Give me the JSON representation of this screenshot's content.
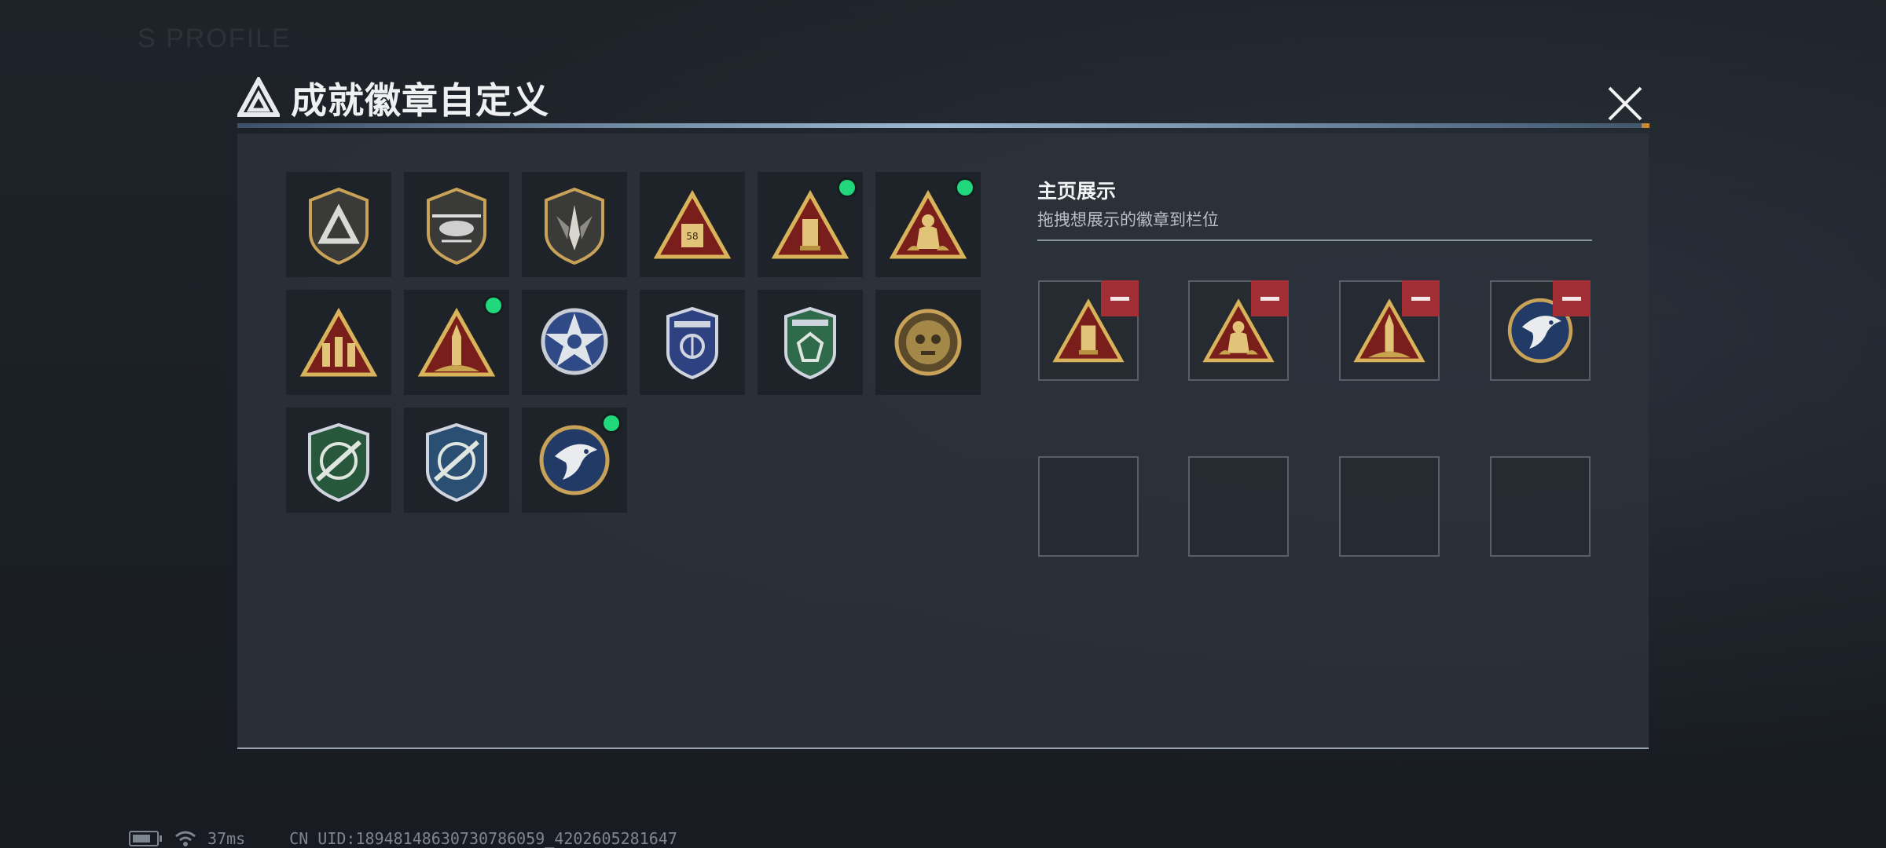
{
  "background": {
    "faint_title": "S PROFILE"
  },
  "dialog": {
    "title": "成就徽章自定义",
    "close_icon": "close-icon",
    "accent_color": "#c98a2d"
  },
  "badges": [
    {
      "icon": "shield-triangle-badge",
      "new": false
    },
    {
      "icon": "helicopter-shield-badge",
      "new": false
    },
    {
      "icon": "dagger-shield-badge",
      "new": false
    },
    {
      "icon": "triangle-58-badge",
      "new": false
    },
    {
      "icon": "triangle-vault-badge",
      "new": true
    },
    {
      "icon": "triangle-soldier-badge",
      "new": true
    },
    {
      "icon": "triangle-squad-badge",
      "new": false
    },
    {
      "icon": "triangle-missile-badge",
      "new": true
    },
    {
      "icon": "silver-star-badge",
      "new": false
    },
    {
      "icon": "blue-wing-shield-badge",
      "new": false
    },
    {
      "icon": "green-gem-shield-badge",
      "new": false
    },
    {
      "icon": "gold-mask-badge",
      "new": false
    },
    {
      "icon": "green-crosshair-shield-badge",
      "new": false
    },
    {
      "icon": "blue-crosshair-shield-badge",
      "new": false
    },
    {
      "icon": "eagle-badge",
      "new": true
    }
  ],
  "showcase": {
    "title": "主页展示",
    "subtitle": "拖拽想展示的徽章到栏位",
    "slots": [
      {
        "icon": "triangle-vault-badge",
        "filled": true
      },
      {
        "icon": "triangle-soldier-badge",
        "filled": true
      },
      {
        "icon": "triangle-missile-badge",
        "filled": true
      },
      {
        "icon": "eagle-badge",
        "filled": true
      },
      {
        "filled": false
      },
      {
        "filled": false
      },
      {
        "filled": false
      },
      {
        "filled": false
      }
    ]
  },
  "status_bar": {
    "ping": "37ms",
    "uid": "CN UID:18948148630730786059_4202605281647"
  }
}
